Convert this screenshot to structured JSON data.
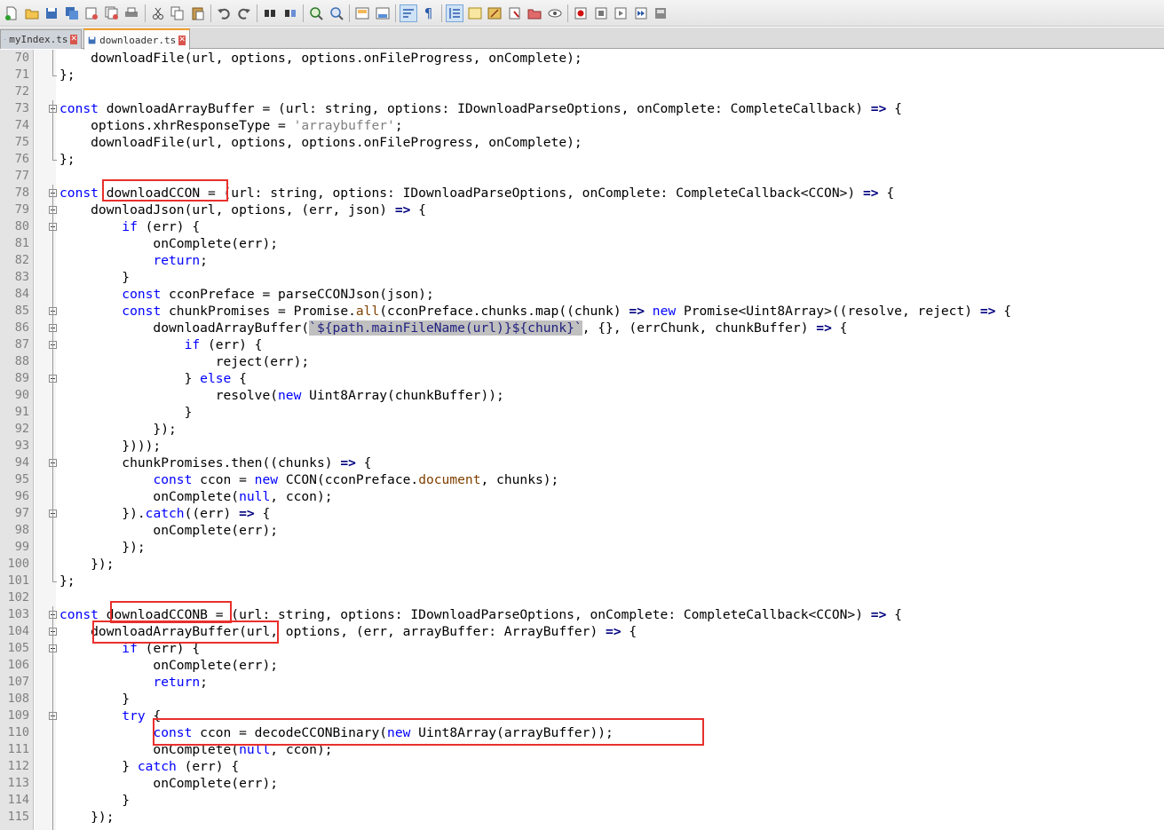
{
  "toolbar": {
    "icons": [
      "new-file-icon",
      "open-file-icon",
      "save-icon",
      "save-all-icon",
      "close-icon",
      "close-all-icon",
      "print-icon",
      "cut-icon",
      "copy-icon",
      "paste-icon",
      "undo-icon",
      "redo-icon",
      "find-icon",
      "replace-icon",
      "zoom-in-icon",
      "zoom-out-icon",
      "sync-vertical-icon",
      "sync-horizontal-icon",
      "word-wrap-icon",
      "show-all-chars-icon",
      "indent-guide-icon",
      "doc-map-icon",
      "function-list-icon",
      "folder-workspace-icon",
      "monitoring-icon",
      "record-macro-icon",
      "stop-macro-icon",
      "play-macro-icon",
      "run-macro-multiple-icon",
      "save-macro-icon"
    ]
  },
  "tabs": [
    {
      "label": "myIndex.ts",
      "active": false
    },
    {
      "label": "downloader.ts",
      "active": true
    }
  ],
  "code_lines": [
    {
      "n": "70",
      "html": "    downloadFile(url, options, options.onFileProgress, onComplete);"
    },
    {
      "n": "71",
      "html": "};"
    },
    {
      "n": "72",
      "html": ""
    },
    {
      "n": "73",
      "html": "<span class='kw'>const</span> downloadArrayBuffer = (url: string, options: IDownloadParseOptions, onComplete: CompleteCallback) <span class='op'>=&gt;</span> {"
    },
    {
      "n": "74",
      "html": "    options.xhrResponseType = <span class='str'>'arraybuffer'</span>;"
    },
    {
      "n": "75",
      "html": "    downloadFile(url, options, options.onFileProgress, onComplete);"
    },
    {
      "n": "76",
      "html": "};"
    },
    {
      "n": "77",
      "html": ""
    },
    {
      "n": "78",
      "html": "<span class='kw'>const</span> downloadCCON = (url: string, options: IDownloadParseOptions, onComplete: CompleteCallback&lt;CCON&gt;) <span class='op'>=&gt;</span> {"
    },
    {
      "n": "79",
      "html": "    downloadJson(url, options, (err, json) <span class='op'>=&gt;</span> {"
    },
    {
      "n": "80",
      "html": "        <span class='kw'>if</span> (err) {"
    },
    {
      "n": "81",
      "html": "            onComplete(err);"
    },
    {
      "n": "82",
      "html": "            <span class='kw'>return</span>;"
    },
    {
      "n": "83",
      "html": "        }"
    },
    {
      "n": "84",
      "html": "        <span class='kw'>const</span> cconPreface = parseCCONJson(json);"
    },
    {
      "n": "85",
      "html": "        <span class='kw'>const</span> chunkPromises = Promise.<span class='prop'>all</span>(cconPreface.chunks.map((chunk) <span class='op'>=&gt;</span> <span class='kw'>new</span> Promise&lt;Uint8Array&gt;((resolve, reject) <span class='op'>=&gt;</span> {"
    },
    {
      "n": "86",
      "html": "            downloadArrayBuffer(<span class='tpl'>`${path.mainFileName(url)}${chunk}`</span>, {}, (errChunk, chunkBuffer) <span class='op'>=&gt;</span> {"
    },
    {
      "n": "87",
      "html": "                <span class='kw'>if</span> (err) {"
    },
    {
      "n": "88",
      "html": "                    reject(err);"
    },
    {
      "n": "89",
      "html": "                } <span class='kw'>else</span> {"
    },
    {
      "n": "90",
      "html": "                    resolve(<span class='kw'>new</span> Uint8Array(chunkBuffer));"
    },
    {
      "n": "91",
      "html": "                }"
    },
    {
      "n": "92",
      "html": "            });"
    },
    {
      "n": "93",
      "html": "        })));"
    },
    {
      "n": "94",
      "html": "        chunkPromises.then((chunks) <span class='op'>=&gt;</span> {"
    },
    {
      "n": "95",
      "html": "            <span class='kw'>const</span> ccon = <span class='kw'>new</span> CCON(cconPreface.<span class='prop'>document</span>, chunks);"
    },
    {
      "n": "96",
      "html": "            onComplete(<span class='kw'>null</span>, ccon);"
    },
    {
      "n": "97",
      "html": "        }).<span class='kw'>catch</span>((err) <span class='op'>=&gt;</span> {"
    },
    {
      "n": "98",
      "html": "            onComplete(err);"
    },
    {
      "n": "99",
      "html": "        });"
    },
    {
      "n": "100",
      "html": "    });"
    },
    {
      "n": "101",
      "html": "};"
    },
    {
      "n": "102",
      "html": ""
    },
    {
      "n": "103",
      "html": "<span class='kw'>const</span> downloadCCONB = (url: string, options: IDownloadParseOptions, onComplete: CompleteCallback&lt;CCON&gt;) <span class='op'>=&gt;</span> {"
    },
    {
      "n": "104",
      "html": "    downloadArrayBuffer(url, options, (err, arrayBuffer: ArrayBuffer) <span class='op'>=&gt;</span> {"
    },
    {
      "n": "105",
      "html": "        <span class='kw'>if</span> (err) {"
    },
    {
      "n": "106",
      "html": "            onComplete(err);"
    },
    {
      "n": "107",
      "html": "            <span class='kw'>return</span>;"
    },
    {
      "n": "108",
      "html": "        }"
    },
    {
      "n": "109",
      "html": "        <span class='kw'>try</span> {"
    },
    {
      "n": "110",
      "html": "            <span class='kw'>const</span> ccon = decodeCCONBinary(<span class='kw'>new</span> Uint8Array(arrayBuffer));"
    },
    {
      "n": "111",
      "html": "            onComplete(<span class='kw'>null</span>, ccon);"
    },
    {
      "n": "112",
      "html": "        } <span class='kw'>catch</span> (err) {"
    },
    {
      "n": "113",
      "html": "            onComplete(err);"
    },
    {
      "n": "114",
      "html": "        }"
    },
    {
      "n": "115",
      "html": "    });"
    }
  ],
  "annotation_color": "#e8302c"
}
